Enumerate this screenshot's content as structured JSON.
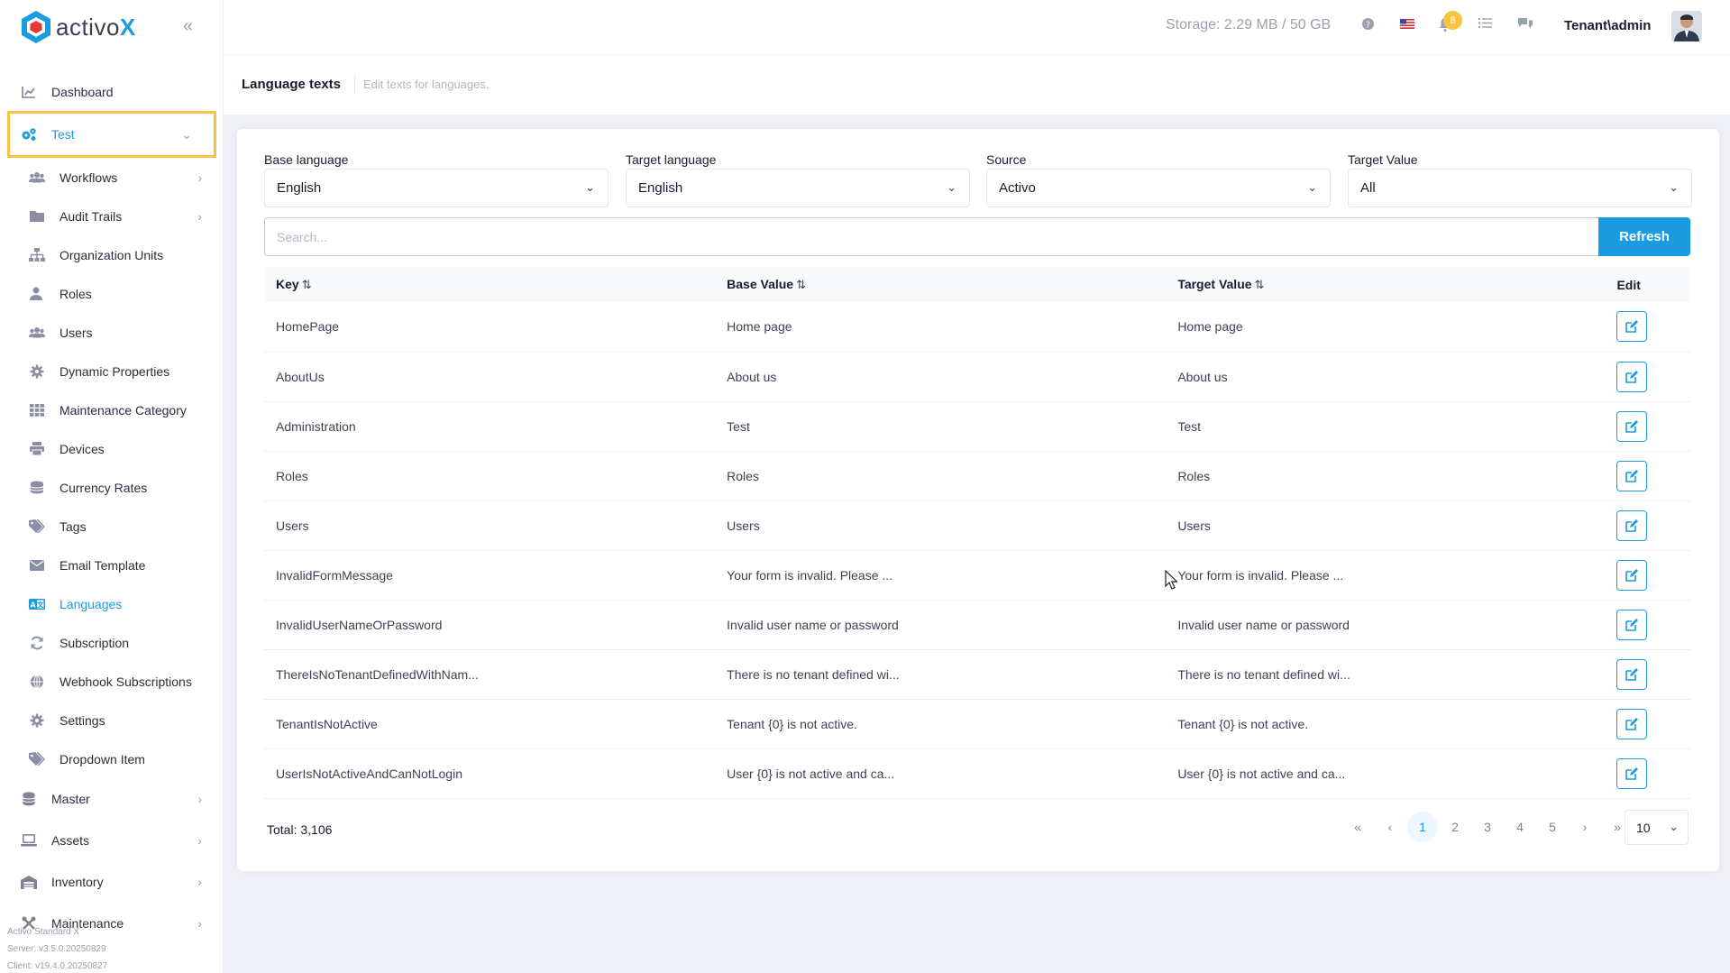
{
  "brand": {
    "name": "activo",
    "name_x": "X"
  },
  "header": {
    "storage": "Storage: 2.29 MB / 50 GB",
    "notification_count": "8",
    "user": "Tenant\\admin"
  },
  "sidebar": {
    "items": [
      {
        "label": "Dashboard",
        "icon": "chart-line-icon"
      },
      {
        "label": "Test",
        "icon": "cogs-icon"
      }
    ],
    "test_children": [
      {
        "label": "Workflows",
        "icon": "users-icon",
        "chevron": true
      },
      {
        "label": "Audit Trails",
        "icon": "folder-icon",
        "chevron": true
      },
      {
        "label": "Organization Units",
        "icon": "sitemap-icon",
        "chevron": false
      },
      {
        "label": "Roles",
        "icon": "user-role-icon",
        "chevron": false
      },
      {
        "label": "Users",
        "icon": "users-icon",
        "chevron": false
      },
      {
        "label": "Dynamic Properties",
        "icon": "gear-icon",
        "chevron": false
      },
      {
        "label": "Maintenance Category",
        "icon": "grid-icon",
        "chevron": false
      },
      {
        "label": "Devices",
        "icon": "printer-icon",
        "chevron": false
      },
      {
        "label": "Currency Rates",
        "icon": "coins-icon",
        "chevron": false
      },
      {
        "label": "Tags",
        "icon": "tags-icon",
        "chevron": false
      },
      {
        "label": "Email Template",
        "icon": "envelope-icon",
        "chevron": false
      },
      {
        "label": "Languages",
        "icon": "language-icon",
        "chevron": false
      },
      {
        "label": "Subscription",
        "icon": "refresh-icon",
        "chevron": false
      },
      {
        "label": "Webhook Subscriptions",
        "icon": "globe-icon",
        "chevron": false
      },
      {
        "label": "Settings",
        "icon": "gear-icon",
        "chevron": false
      },
      {
        "label": "Dropdown Item",
        "icon": "tags-icon",
        "chevron": false
      }
    ],
    "bottom_items": [
      {
        "label": "Master",
        "icon": "database-icon"
      },
      {
        "label": "Assets",
        "icon": "laptop-icon"
      },
      {
        "label": "Inventory",
        "icon": "warehouse-icon"
      },
      {
        "label": "Maintenance",
        "icon": "tools-icon"
      }
    ],
    "version_lines": [
      "Activo Standard X",
      "Server: v3.5.0.20250829",
      "Client: v19.4.0.20250827"
    ]
  },
  "page": {
    "title": "Language texts",
    "description": "Edit texts for languages."
  },
  "filters": {
    "base_language": {
      "label": "Base language",
      "value": "English"
    },
    "target_language": {
      "label": "Target language",
      "value": "English"
    },
    "source": {
      "label": "Source",
      "value": "Activo"
    },
    "target_value": {
      "label": "Target Value",
      "value": "All"
    }
  },
  "search": {
    "placeholder": "Search...",
    "button": "Refresh"
  },
  "table": {
    "columns": [
      "Key",
      "Base Value",
      "Target Value",
      "Edit"
    ],
    "rows": [
      [
        "HomePage",
        "Home page",
        "Home page"
      ],
      [
        "AboutUs",
        "About us",
        "About us"
      ],
      [
        "Administration",
        "Test",
        "Test"
      ],
      [
        "Roles",
        "Roles",
        "Roles"
      ],
      [
        "Users",
        "Users",
        "Users"
      ],
      [
        "InvalidFormMessage",
        "Your form is invalid. Please ...",
        "Your form is invalid. Please ..."
      ],
      [
        "InvalidUserNameOrPassword",
        "Invalid user name or password",
        "Invalid user name or password"
      ],
      [
        "ThereIsNoTenantDefinedWithNam...",
        "There is no tenant defined wi...",
        "There is no tenant defined wi..."
      ],
      [
        "TenantIsNotActive",
        "Tenant {0} is not active.",
        "Tenant {0} is not active."
      ],
      [
        "UserIsNotActiveAndCanNotLogin",
        "User {0} is not active and ca...",
        "User {0} is not active and ca..."
      ]
    ]
  },
  "pagination": {
    "total": "Total: 3,106",
    "pages": [
      "1",
      "2",
      "3",
      "4",
      "5"
    ],
    "current": "1",
    "page_size": "10"
  },
  "colors": {
    "accent": "#1b9be0",
    "highlight": "#f6c344"
  }
}
